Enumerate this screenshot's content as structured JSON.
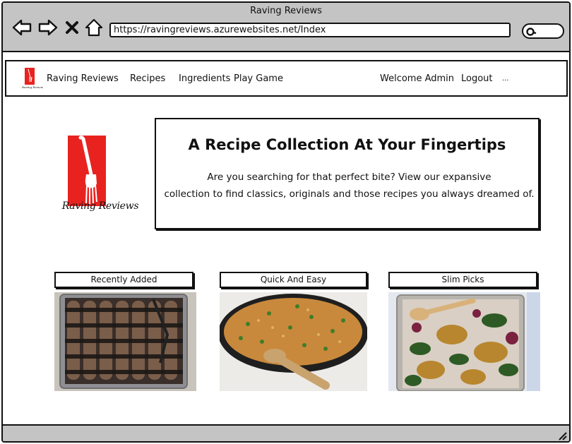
{
  "window": {
    "title": "Raving Reviews"
  },
  "browser": {
    "url": "https://ravingreviews.azurewebsites.net/Index",
    "back_icon": "back-arrow-icon",
    "forward_icon": "forward-arrow-icon",
    "close_icon": "close-icon",
    "home_icon": "home-icon",
    "search_icon": "search-icon"
  },
  "navbar": {
    "brand": "Raving Reviews",
    "links": [
      "Recipes",
      "Ingredients",
      "Play Game"
    ],
    "welcome": "Welcome Admin",
    "logout": "Logout",
    "more": "..."
  },
  "hero": {
    "logo_text": "Raving Reviews",
    "title": "A Recipe Collection At Your Fingertips",
    "line1": "Are you searching for that perfect bite?  View our expansive",
    "line2": "collection to find classics, originals and those recipes you always dreamed of."
  },
  "cards": [
    {
      "label": "Recently Added"
    },
    {
      "label": "Quick And Easy"
    },
    {
      "label": "Slim Picks"
    }
  ],
  "colors": {
    "chrome": "#c4c4c4",
    "brand_red": "#e8231f"
  }
}
